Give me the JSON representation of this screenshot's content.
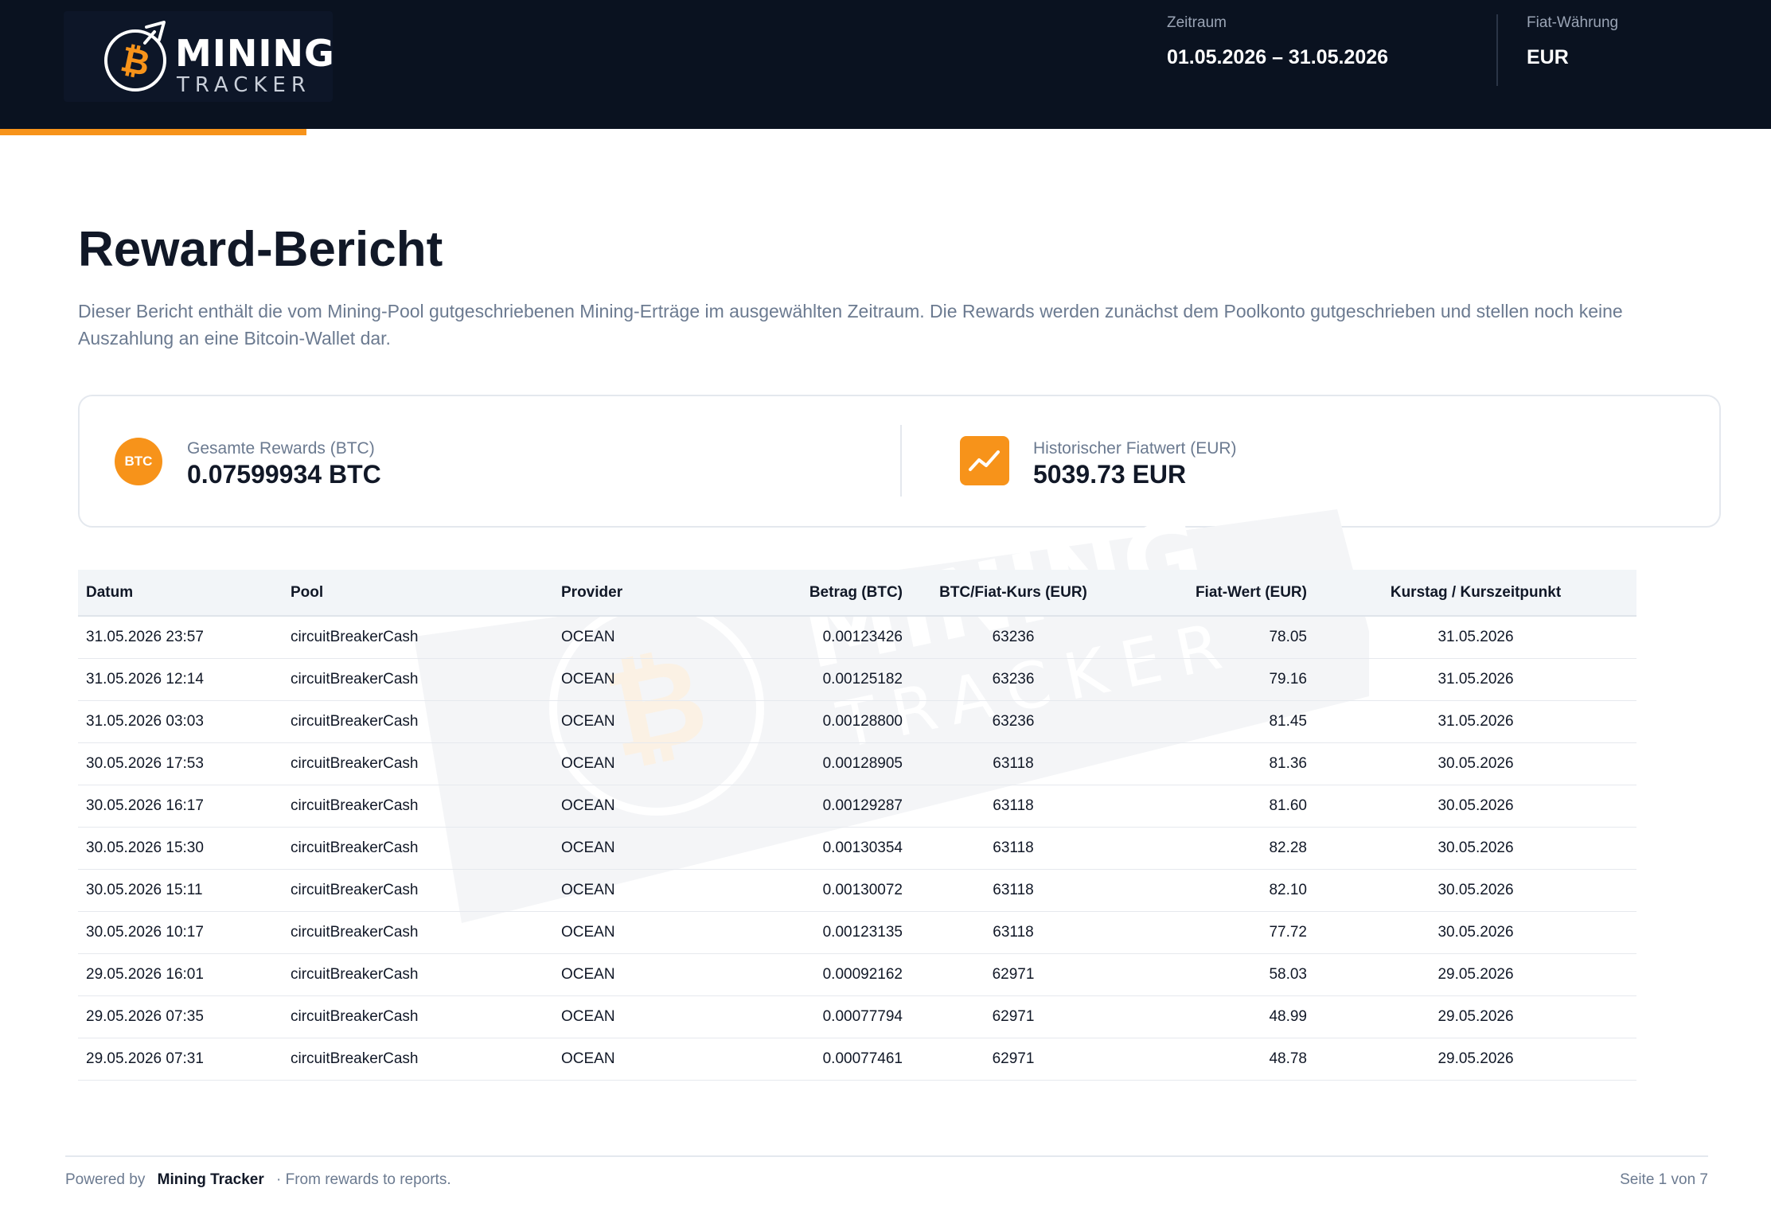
{
  "brand": {
    "line1": "MINING",
    "line2": "TRACKER"
  },
  "header": {
    "period_label": "Zeitraum",
    "period_value": "01.05.2026 – 31.05.2026",
    "currency_label": "Fiat-Währung",
    "currency_value": "EUR"
  },
  "report": {
    "title": "Reward-Bericht",
    "description": "Dieser Bericht enthält die vom Mining-Pool gutgeschriebenen Mining-Erträge im ausgewählten Zeitraum. Die Rewards werden zunächst dem Poolkonto gutgeschrieben und stellen noch keine Auszahlung an eine Bitcoin-Wallet dar."
  },
  "summary": {
    "btc_badge": "BTC",
    "total_label": "Gesamte Rewards (BTC)",
    "total_value": "0.07599934 BTC",
    "fiat_label": "Historischer Fiatwert (EUR)",
    "fiat_value": "5039.73 EUR"
  },
  "table": {
    "columns": [
      "Datum",
      "Pool",
      "Provider",
      "Betrag (BTC)",
      "BTC/Fiat-Kurs (EUR)",
      "Fiat-Wert (EUR)",
      "Kurstag / Kurszeitpunkt"
    ],
    "rows": [
      [
        "31.05.2026 23:57",
        "circuitBreakerCash",
        "OCEAN",
        "0.00123426",
        "63236",
        "78.05",
        "31.05.2026"
      ],
      [
        "31.05.2026 12:14",
        "circuitBreakerCash",
        "OCEAN",
        "0.00125182",
        "63236",
        "79.16",
        "31.05.2026"
      ],
      [
        "31.05.2026 03:03",
        "circuitBreakerCash",
        "OCEAN",
        "0.00128800",
        "63236",
        "81.45",
        "31.05.2026"
      ],
      [
        "30.05.2026 17:53",
        "circuitBreakerCash",
        "OCEAN",
        "0.00128905",
        "63118",
        "81.36",
        "30.05.2026"
      ],
      [
        "30.05.2026 16:17",
        "circuitBreakerCash",
        "OCEAN",
        "0.00129287",
        "63118",
        "81.60",
        "30.05.2026"
      ],
      [
        "30.05.2026 15:30",
        "circuitBreakerCash",
        "OCEAN",
        "0.00130354",
        "63118",
        "82.28",
        "30.05.2026"
      ],
      [
        "30.05.2026 15:11",
        "circuitBreakerCash",
        "OCEAN",
        "0.00130072",
        "63118",
        "82.10",
        "30.05.2026"
      ],
      [
        "30.05.2026 10:17",
        "circuitBreakerCash",
        "OCEAN",
        "0.00123135",
        "63118",
        "77.72",
        "30.05.2026"
      ],
      [
        "29.05.2026 16:01",
        "circuitBreakerCash",
        "OCEAN",
        "0.00092162",
        "62971",
        "58.03",
        "29.05.2026"
      ],
      [
        "29.05.2026 07:35",
        "circuitBreakerCash",
        "OCEAN",
        "0.00077794",
        "62971",
        "48.99",
        "29.05.2026"
      ],
      [
        "29.05.2026 07:31",
        "circuitBreakerCash",
        "OCEAN",
        "0.00077461",
        "62971",
        "48.78",
        "29.05.2026"
      ]
    ]
  },
  "footer": {
    "powered_by": "Powered by",
    "brand": "Mining Tracker",
    "tagline": "· From rewards to reports.",
    "page": "Seite 1 von 7"
  },
  "colors": {
    "header_bg": "#0a1220",
    "accent": "#f7931a",
    "text_primary": "#111827",
    "text_muted": "#6b7a90"
  },
  "icons": {
    "logo": "bitcoin-pickaxe-icon",
    "btc_badge": "btc-icon",
    "fiat_badge": "trend-chart-icon"
  }
}
